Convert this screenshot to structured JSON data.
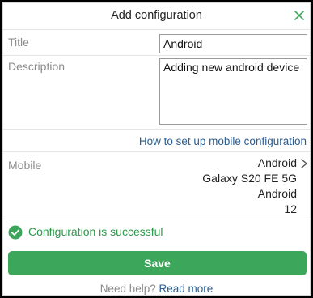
{
  "dialog": {
    "title": "Add configuration",
    "accent_color": "#3ca65a",
    "link_color": "#2a5f93"
  },
  "form": {
    "title_label": "Title",
    "title_value": "Android",
    "description_label": "Description",
    "description_value": "Adding new android device",
    "howto_link": "How to set up mobile configuration",
    "mobile_label": "Mobile",
    "mobile_lines": [
      "Android",
      "Galaxy S20 FE 5G",
      "Android",
      "12"
    ]
  },
  "status": {
    "success_text": "Configuration is successful",
    "icon": "check-circle-icon"
  },
  "actions": {
    "save_label": "Save"
  },
  "help": {
    "prefix": "Need help?",
    "link": "Read more"
  }
}
